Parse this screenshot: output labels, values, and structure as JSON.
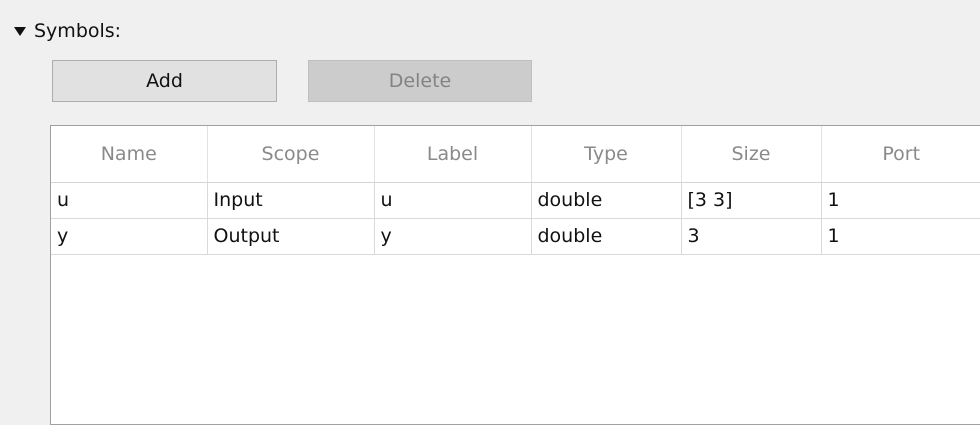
{
  "section": {
    "title": "Symbols:",
    "toggle_icon": "triangle-down-icon"
  },
  "buttons": {
    "add_label": "Add",
    "delete_label": "Delete"
  },
  "table": {
    "columns": [
      "Name",
      "Scope",
      "Label",
      "Type",
      "Size",
      "Port"
    ],
    "rows": [
      [
        "u",
        "Input",
        "u",
        "double",
        "[3 3]",
        "1"
      ],
      [
        "y",
        "Output",
        "y",
        "double",
        "3",
        "1"
      ]
    ]
  }
}
